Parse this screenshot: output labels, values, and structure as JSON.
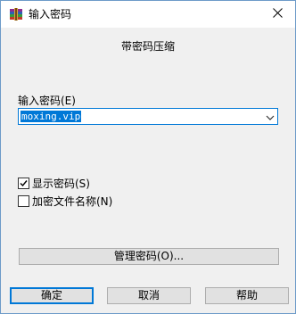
{
  "window": {
    "title": "输入密码",
    "close_icon": "close-icon",
    "app_icon": "winrar-icon"
  },
  "dialog": {
    "heading": "带密码压缩"
  },
  "password": {
    "label": "输入密码(E)",
    "value": "moxing.vip",
    "dropdown_icon": "chevron-down-icon"
  },
  "options": {
    "show_password": {
      "label": "显示密码(S)",
      "checked": true
    },
    "encrypt_filenames": {
      "label": "加密文件名称(N)",
      "checked": false
    }
  },
  "buttons": {
    "manage": "管理密码(O)...",
    "ok": "确定",
    "cancel": "取消",
    "help": "帮助"
  },
  "colors": {
    "accent": "#0078d7",
    "window_bg": "#f0f0f0",
    "button_bg": "#e1e1e1",
    "button_border": "#adadad"
  }
}
